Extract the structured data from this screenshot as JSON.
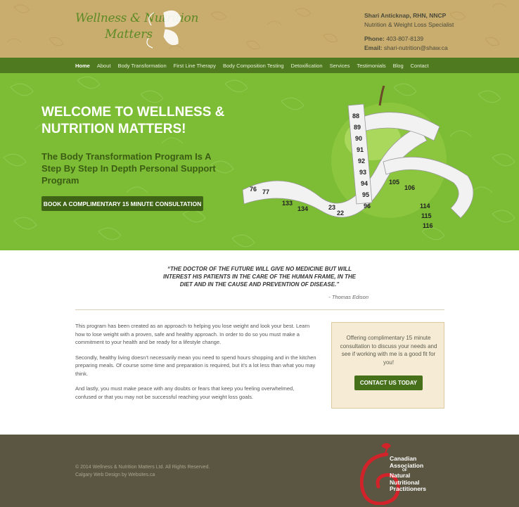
{
  "brand": {
    "logo_line1": "Wellness & Nutrition",
    "logo_line2": "Matters"
  },
  "contact": {
    "name": "Shari Anticknap, RHN, NNCP",
    "title": "Nutrition & Weight Loss Specialist",
    "phone_label": "Phone:",
    "phone": "403-807-8139",
    "email_label": "Email:",
    "email": "shari-nutrition@shaw.ca"
  },
  "nav": {
    "items": [
      {
        "label": "Home"
      },
      {
        "label": "About"
      },
      {
        "label": "Body Transformation"
      },
      {
        "label": "First Line Therapy"
      },
      {
        "label": "Body Composition Testing"
      },
      {
        "label": "Detoxification"
      },
      {
        "label": "Services"
      },
      {
        "label": "Testimonials"
      },
      {
        "label": "Blog"
      },
      {
        "label": "Contact"
      }
    ],
    "active": "Home"
  },
  "hero": {
    "title": "WELCOME TO WELLNESS & NUTRITION MATTERS!",
    "subtitle": "The Body Transformation Program Is A Step By Step In Depth Personal Support Program",
    "cta": "BOOK A COMPLIMENTARY 15 MINUTE CONSULTATION",
    "tape_numbers": [
      "88",
      "89",
      "90",
      "91",
      "92",
      "93",
      "94",
      "95",
      "96",
      "105",
      "106",
      "114",
      "115",
      "116",
      "133",
      "134",
      "23",
      "22",
      "76",
      "77"
    ]
  },
  "quote": {
    "text": "“THE DOCTOR OF THE FUTURE WILL GIVE NO MEDICINE BUT WILL INTEREST HIS PATIENTS IN THE CARE OF THE HUMAN FRAME, IN THE DIET AND IN THE CAUSE AND PREVENTION OF DISEASE.”",
    "author": "- Thomas Edison"
  },
  "body": {
    "p1": "This program has been created as an approach to helping you lose weight and look your best. Learn how to lose weight with a proven, safe and healthy approach. In order to do so you must make a commitment to your health and be ready for a lifestyle change.",
    "p2": "Secondly, healthy living doesn’t necessarily mean you need to spend hours shopping and in the kitchen preparing meals. Of course some time and preparation is required, but it’s a lot less than what you may think.",
    "p3": "And lastly, you must make peace with any doubts or fears that keep you feeling overwhelmed, confused or that you may not be successful reaching your weight loss goals."
  },
  "sidebox": {
    "text": "Offering complimentary 15 minute consultation to discuss your needs and see if working with me is a good fit for you!",
    "button": "CONTACT US TODAY"
  },
  "footer": {
    "copyright": "© 2014 Wellness & Nutrition Matters Ltd. All Rights Reserved.",
    "credit": "Calgary Web Design by Websites.ca",
    "association": {
      "line1": "Canadian",
      "line2": "Association",
      "of": "OF",
      "line3": "Natural",
      "line4": "Nutritional",
      "line5": "Practitioners"
    }
  },
  "colors": {
    "header_bg": "#c9ad6e",
    "nav_bg": "#4f7a1f",
    "hero_bg": "#7cbd35",
    "button_bg": "#3f6416",
    "footer_bg": "#5a5642",
    "accent_red": "#d2232a"
  }
}
